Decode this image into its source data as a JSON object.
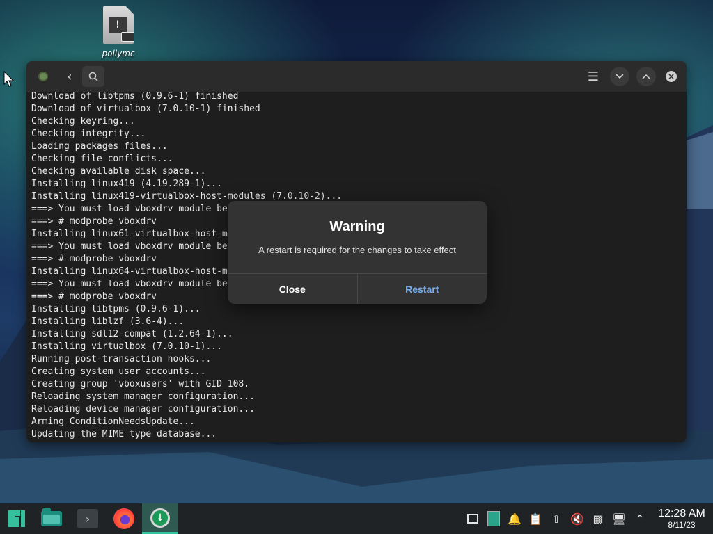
{
  "desktop": {
    "icon_label": "pollymc"
  },
  "terminal": {
    "lines": [
      "Download of libtpms (0.9.6-1) finished",
      "Download of virtualbox (7.0.10-1) finished",
      "Checking keyring...",
      "Checking integrity...",
      "Loading packages files...",
      "Checking file conflicts...",
      "Checking available disk space...",
      "Installing linux419 (4.19.289-1)...",
      "Installing linux419-virtualbox-host-modules (7.0.10-2)...",
      "===> You must load vboxdrv module be",
      "===> # modprobe vboxdrv",
      "Installing linux61-virtualbox-host-m",
      "===> You must load vboxdrv module be",
      "===> # modprobe vboxdrv",
      "Installing linux64-virtualbox-host-m",
      "===> You must load vboxdrv module be",
      "===> # modprobe vboxdrv",
      "Installing libtpms (0.9.6-1)...",
      "Installing liblzf (3.6-4)...",
      "Installing sdl12-compat (1.2.64-1)...",
      "Installing virtualbox (7.0.10-1)...",
      "Running post-transaction hooks...",
      "Creating system user accounts...",
      "Creating group 'vboxusers' with GID 108.",
      "Reloading system manager configuration...",
      "Reloading device manager configuration...",
      "Arming ConditionNeedsUpdate...",
      "Updating the MIME type database..."
    ]
  },
  "dialog": {
    "title": "Warning",
    "message": "A restart is required for the changes to take effect",
    "close_label": "Close",
    "restart_label": "Restart"
  },
  "taskbar": {
    "clock_time": "12:28 AM",
    "clock_date": "8/11/23"
  }
}
